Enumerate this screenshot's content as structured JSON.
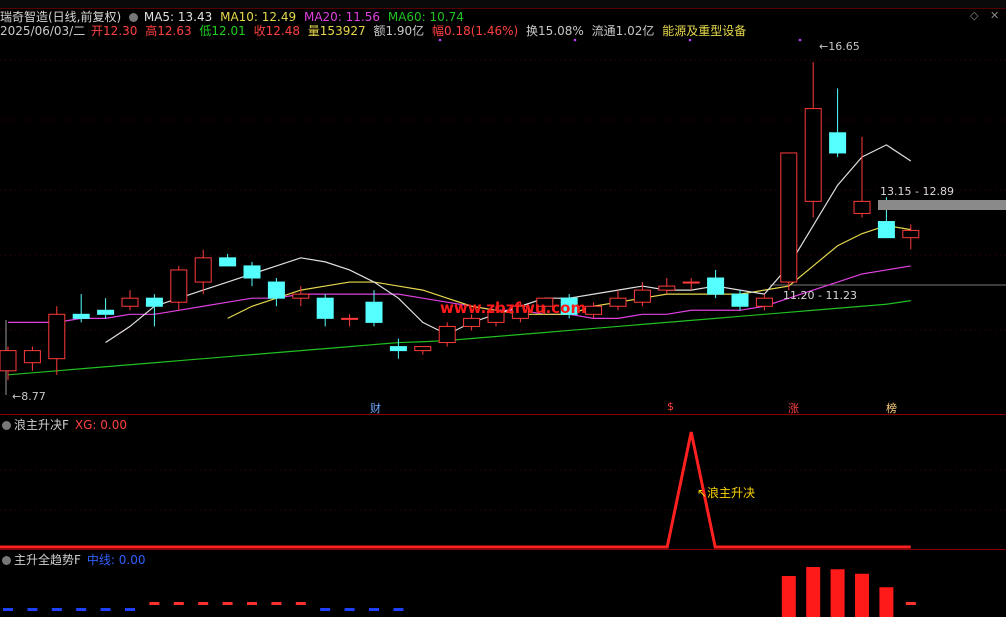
{
  "header": {
    "stock_name": "瑞奇智造(日线,前复权)",
    "ma5": "MA5: 13.43",
    "ma10": "MA10: 12.49",
    "ma20": "MA20: 11.56",
    "ma60": "MA60: 10.74",
    "date": "2025/06/03/二",
    "open": "开12.30",
    "high": "高12.63",
    "low": "低12.01",
    "close": "收12.48",
    "volume": "量153927",
    "amount": "额1.90亿",
    "change": "幅0.18(1.46%)",
    "turnover": "换15.08%",
    "float": "流通1.02亿",
    "sector": "能源及重型设备"
  },
  "window_controls": {
    "restore": "◇",
    "close": "✕"
  },
  "colors": {
    "up": "#ff3b3b",
    "down": "#54ffff",
    "ma5": "#e0e0e0",
    "ma10": "#e6d84c",
    "ma20": "#e040e0",
    "ma60": "#20c020"
  },
  "price_annotations": {
    "high_label": "16.65",
    "low_label": "8.77",
    "range_upper": "13.15 - 12.89",
    "range_lower": "11.20 - 11.23"
  },
  "event_markers": [
    {
      "label": "财",
      "color": "#6ea8ff"
    },
    {
      "label": "$",
      "color": "#ff4040"
    },
    {
      "label": "涨",
      "color": "#ff4040"
    },
    {
      "label": "榜",
      "color": "#ffd27f"
    }
  ],
  "watermark": "www.zbzfwu.com",
  "panel2": {
    "title": "浪主升决F",
    "indicator": "XG: 0.00",
    "signal_label": "↖浪主升决"
  },
  "panel3": {
    "title": "主升全趋势F",
    "indicator": "中线: 0.00"
  },
  "chart_data": {
    "type": "candlestick",
    "y_range": [
      8.4,
      17.2
    ],
    "candles": [
      {
        "o": 9.0,
        "h": 9.6,
        "l": 8.77,
        "c": 9.5
      },
      {
        "o": 9.2,
        "h": 9.6,
        "l": 9.0,
        "c": 9.5
      },
      {
        "o": 9.3,
        "h": 10.6,
        "l": 8.9,
        "c": 10.4
      },
      {
        "o": 10.4,
        "h": 10.9,
        "l": 10.2,
        "c": 10.3
      },
      {
        "o": 10.5,
        "h": 10.8,
        "l": 10.3,
        "c": 10.4
      },
      {
        "o": 10.6,
        "h": 11.0,
        "l": 10.5,
        "c": 10.8
      },
      {
        "o": 10.8,
        "h": 10.9,
        "l": 10.1,
        "c": 10.6
      },
      {
        "o": 10.7,
        "h": 11.6,
        "l": 10.5,
        "c": 11.5
      },
      {
        "o": 11.2,
        "h": 12.0,
        "l": 10.9,
        "c": 11.8
      },
      {
        "o": 11.8,
        "h": 11.9,
        "l": 11.6,
        "c": 11.6
      },
      {
        "o": 11.6,
        "h": 11.7,
        "l": 11.1,
        "c": 11.3
      },
      {
        "o": 11.2,
        "h": 11.3,
        "l": 10.6,
        "c": 10.8
      },
      {
        "o": 10.8,
        "h": 11.1,
        "l": 10.6,
        "c": 10.9
      },
      {
        "o": 10.8,
        "h": 10.9,
        "l": 10.1,
        "c": 10.3
      },
      {
        "o": 10.3,
        "h": 10.4,
        "l": 10.1,
        "c": 10.3
      },
      {
        "o": 10.7,
        "h": 11.0,
        "l": 10.1,
        "c": 10.2
      },
      {
        "o": 9.6,
        "h": 9.8,
        "l": 9.3,
        "c": 9.5
      },
      {
        "o": 9.5,
        "h": 9.6,
        "l": 9.4,
        "c": 9.6
      },
      {
        "o": 9.7,
        "h": 10.2,
        "l": 9.6,
        "c": 10.1
      },
      {
        "o": 10.1,
        "h": 10.4,
        "l": 10.0,
        "c": 10.3
      },
      {
        "o": 10.2,
        "h": 10.6,
        "l": 10.1,
        "c": 10.5
      },
      {
        "o": 10.3,
        "h": 10.7,
        "l": 10.2,
        "c": 10.6
      },
      {
        "o": 10.6,
        "h": 10.8,
        "l": 10.4,
        "c": 10.8
      },
      {
        "o": 10.8,
        "h": 10.9,
        "l": 10.3,
        "c": 10.4
      },
      {
        "o": 10.4,
        "h": 10.7,
        "l": 10.3,
        "c": 10.6
      },
      {
        "o": 10.6,
        "h": 11.0,
        "l": 10.5,
        "c": 10.8
      },
      {
        "o": 10.7,
        "h": 11.2,
        "l": 10.6,
        "c": 11.0
      },
      {
        "o": 11.0,
        "h": 11.3,
        "l": 10.9,
        "c": 11.1
      },
      {
        "o": 11.2,
        "h": 11.3,
        "l": 11.0,
        "c": 11.2
      },
      {
        "o": 11.3,
        "h": 11.5,
        "l": 10.8,
        "c": 10.9
      },
      {
        "o": 10.9,
        "h": 11.0,
        "l": 10.5,
        "c": 10.6
      },
      {
        "o": 10.6,
        "h": 10.9,
        "l": 10.5,
        "c": 10.8
      },
      {
        "o": 11.2,
        "h": 14.4,
        "l": 11.0,
        "c": 14.4
      },
      {
        "o": 13.2,
        "h": 16.65,
        "l": 12.8,
        "c": 15.5
      },
      {
        "o": 14.9,
        "h": 16.0,
        "l": 14.3,
        "c": 14.4
      },
      {
        "o": 12.9,
        "h": 14.8,
        "l": 12.8,
        "c": 13.2
      },
      {
        "o": 12.7,
        "h": 13.3,
        "l": 12.3,
        "c": 12.3
      },
      {
        "o": 12.3,
        "h": 12.63,
        "l": 12.01,
        "c": 12.48
      }
    ],
    "ma5": [
      null,
      null,
      null,
      null,
      9.7,
      10.1,
      10.6,
      10.8,
      11.0,
      11.2,
      11.4,
      11.6,
      11.8,
      11.7,
      11.5,
      11.2,
      10.8,
      10.2,
      9.9,
      10.2,
      10.4,
      10.6,
      10.8,
      10.8,
      10.9,
      11.0,
      11.1,
      11.0,
      11.0,
      11.1,
      11.0,
      10.9,
      11.6,
      12.6,
      13.6,
      14.3,
      14.6,
      14.2
    ],
    "ma10": [
      null,
      null,
      null,
      null,
      null,
      null,
      null,
      null,
      null,
      10.3,
      10.6,
      10.8,
      11.0,
      11.1,
      11.2,
      11.2,
      11.1,
      11.0,
      10.8,
      10.6,
      10.5,
      10.4,
      10.4,
      10.4,
      10.6,
      10.7,
      10.8,
      10.9,
      10.9,
      10.9,
      10.9,
      11.0,
      11.1,
      11.6,
      12.1,
      12.4,
      12.6,
      12.5
    ],
    "ma20": [
      10.2,
      10.2,
      10.2,
      10.3,
      10.3,
      10.4,
      10.4,
      10.5,
      10.6,
      10.7,
      10.8,
      10.8,
      10.9,
      10.9,
      10.9,
      10.9,
      10.9,
      10.8,
      10.7,
      10.6,
      10.5,
      10.5,
      10.4,
      10.4,
      10.3,
      10.3,
      10.4,
      10.4,
      10.5,
      10.5,
      10.5,
      10.6,
      10.8,
      11.0,
      11.2,
      11.4,
      11.5,
      11.6
    ],
    "ma60": [
      8.9,
      8.95,
      9.0,
      9.05,
      9.1,
      9.15,
      9.2,
      9.25,
      9.3,
      9.35,
      9.4,
      9.45,
      9.5,
      9.55,
      9.6,
      9.65,
      9.7,
      9.72,
      9.75,
      9.8,
      9.85,
      9.9,
      9.95,
      10.0,
      10.05,
      10.1,
      10.15,
      10.2,
      10.25,
      10.3,
      10.35,
      10.4,
      10.45,
      10.5,
      10.55,
      10.6,
      10.65,
      10.74
    ],
    "xg_signal": [
      0,
      0,
      0,
      0,
      0,
      0,
      0,
      0,
      0,
      0,
      0,
      0,
      0,
      0,
      0,
      0,
      0,
      0,
      0,
      0,
      0,
      0,
      0,
      0,
      0,
      0,
      0,
      0,
      1,
      0,
      0,
      0,
      0,
      0,
      0,
      0,
      0,
      0
    ],
    "trend_bars": [
      -0.1,
      -0.12,
      -0.05,
      -0.08,
      -0.08,
      -0.06,
      0.05,
      0.08,
      0.1,
      0.12,
      0.08,
      0.05,
      0.03,
      -0.05,
      -0.1,
      -0.12,
      -0.18,
      null,
      null,
      null,
      null,
      null,
      null,
      null,
      null,
      null,
      null,
      null,
      null,
      null,
      null,
      null,
      0.8,
      1.0,
      0.95,
      0.85,
      0.55,
      0.3
    ]
  }
}
